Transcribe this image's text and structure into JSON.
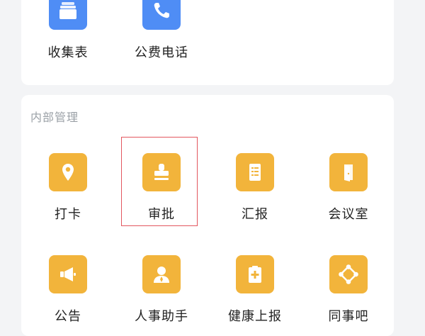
{
  "top_apps": [
    {
      "id": "collect-form",
      "label": "收集表",
      "icon": "form-stack-icon",
      "color": "#4f8df5"
    },
    {
      "id": "public-phone",
      "label": "公费电话",
      "icon": "phone-icon",
      "color": "#4f8df5"
    }
  ],
  "internal": {
    "title": "内部管理",
    "apps": [
      {
        "id": "checkin",
        "label": "打卡",
        "icon": "location-pin-icon"
      },
      {
        "id": "approval",
        "label": "审批",
        "icon": "stamp-icon"
      },
      {
        "id": "report",
        "label": "汇报",
        "icon": "document-icon"
      },
      {
        "id": "meeting-room",
        "label": "会议室",
        "icon": "door-icon"
      },
      {
        "id": "announcement",
        "label": "公告",
        "icon": "megaphone-icon"
      },
      {
        "id": "hr-assistant",
        "label": "人事助手",
        "icon": "person-icon"
      },
      {
        "id": "health-report",
        "label": "健康上报",
        "icon": "medical-clipboard-icon"
      },
      {
        "id": "colleague-bar",
        "label": "同事吧",
        "icon": "network-icon"
      }
    ]
  },
  "colors": {
    "blue": "#4f8df5",
    "yellow": "#f2b43b",
    "highlight": "#e3575f"
  }
}
